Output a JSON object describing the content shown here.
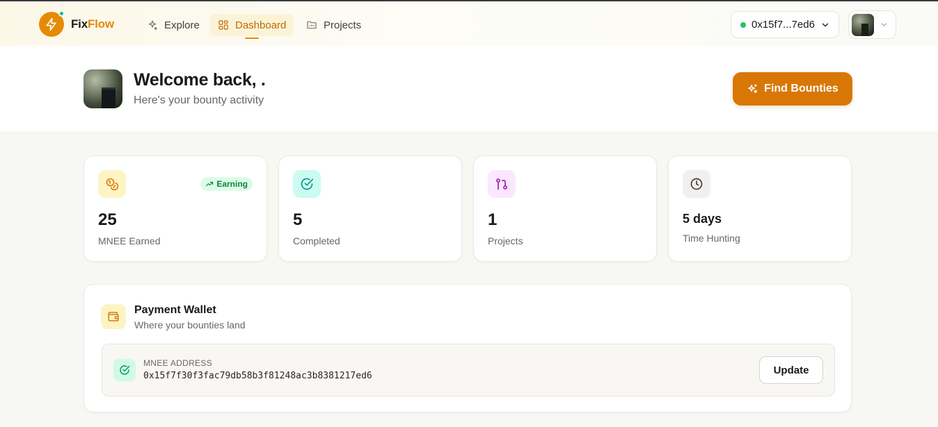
{
  "brand": {
    "name_part1": "Fix",
    "name_part2": "Flow",
    "accent": "#e68a06"
  },
  "nav": {
    "items": [
      {
        "label": "Explore",
        "icon": "sparkles-icon"
      },
      {
        "label": "Dashboard",
        "icon": "grid-icon",
        "active": true
      },
      {
        "label": "Projects",
        "icon": "folder-icon"
      }
    ],
    "wallet_short": "0x15f7...7ed6"
  },
  "welcome": {
    "title": "Welcome back, .",
    "subtitle": "Here's your bounty activity",
    "cta": "Find Bounties"
  },
  "stats": [
    {
      "value": "25",
      "label": "MNEE Earned",
      "badge": "Earning",
      "icon": "coins-icon"
    },
    {
      "value": "5",
      "label": "Completed",
      "icon": "check-circle-icon"
    },
    {
      "value": "1",
      "label": "Projects",
      "icon": "git-pull-request-icon"
    },
    {
      "value": "5 days",
      "label": "Time Hunting",
      "icon": "clock-icon"
    }
  ],
  "wallet": {
    "title": "Payment Wallet",
    "subtitle": "Where your bounties land",
    "address_label": "MNEE ADDRESS",
    "address": "0x15f7f30f3fac79db58b3f81248ac3b8381217ed6",
    "update_label": "Update"
  }
}
